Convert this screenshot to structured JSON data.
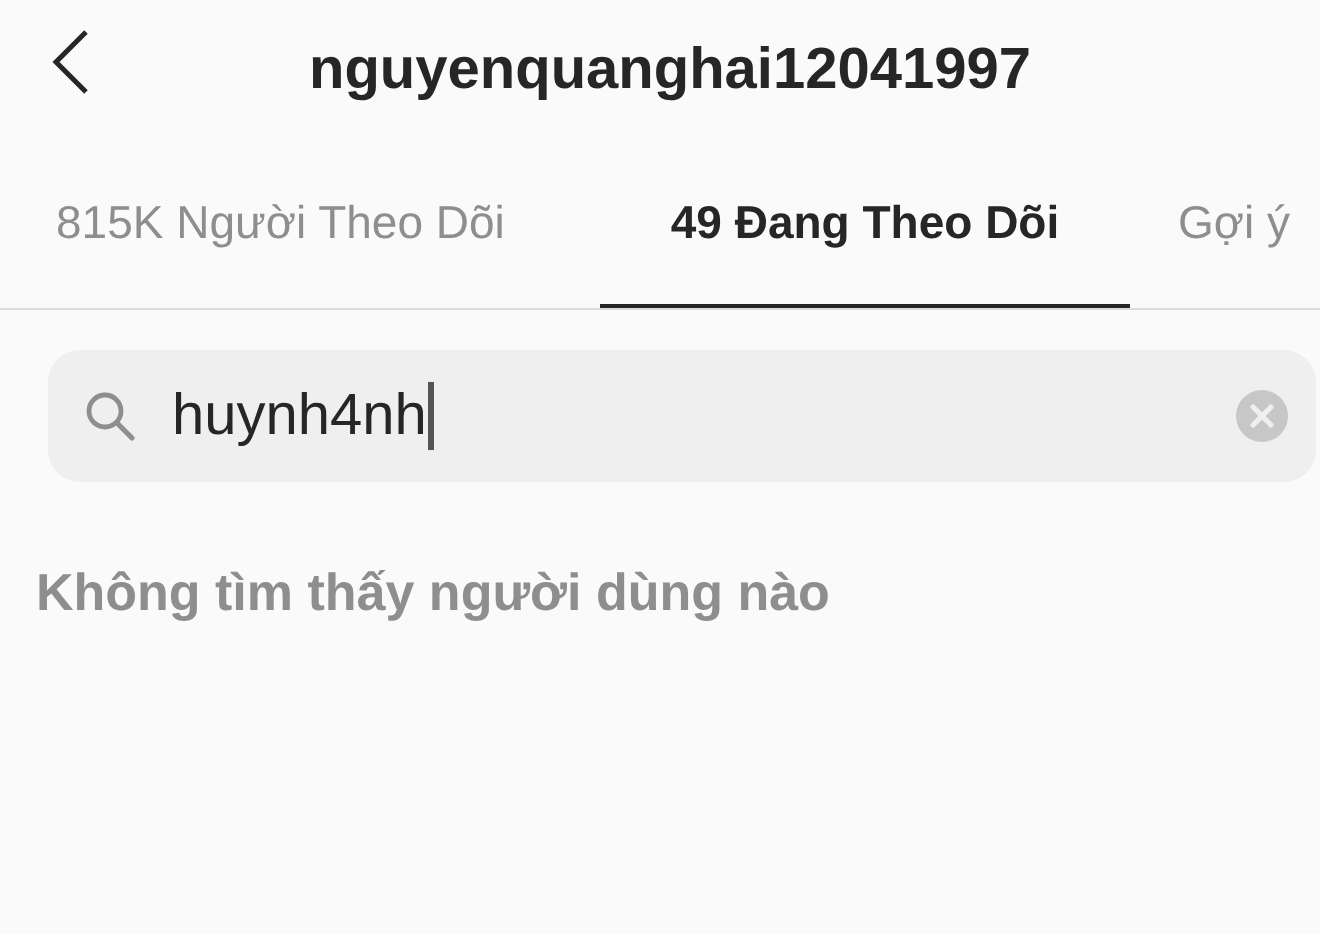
{
  "header": {
    "title": "nguyenquanghai12041997"
  },
  "tabs": [
    {
      "label": "815K Người Theo Dõi",
      "selected": false
    },
    {
      "label": "49 Đang Theo Dõi",
      "selected": true
    },
    {
      "label": "Gợi ý",
      "selected": false
    }
  ],
  "search": {
    "value": "huynh4nh"
  },
  "message": "Không tìm thấy người dùng nào"
}
